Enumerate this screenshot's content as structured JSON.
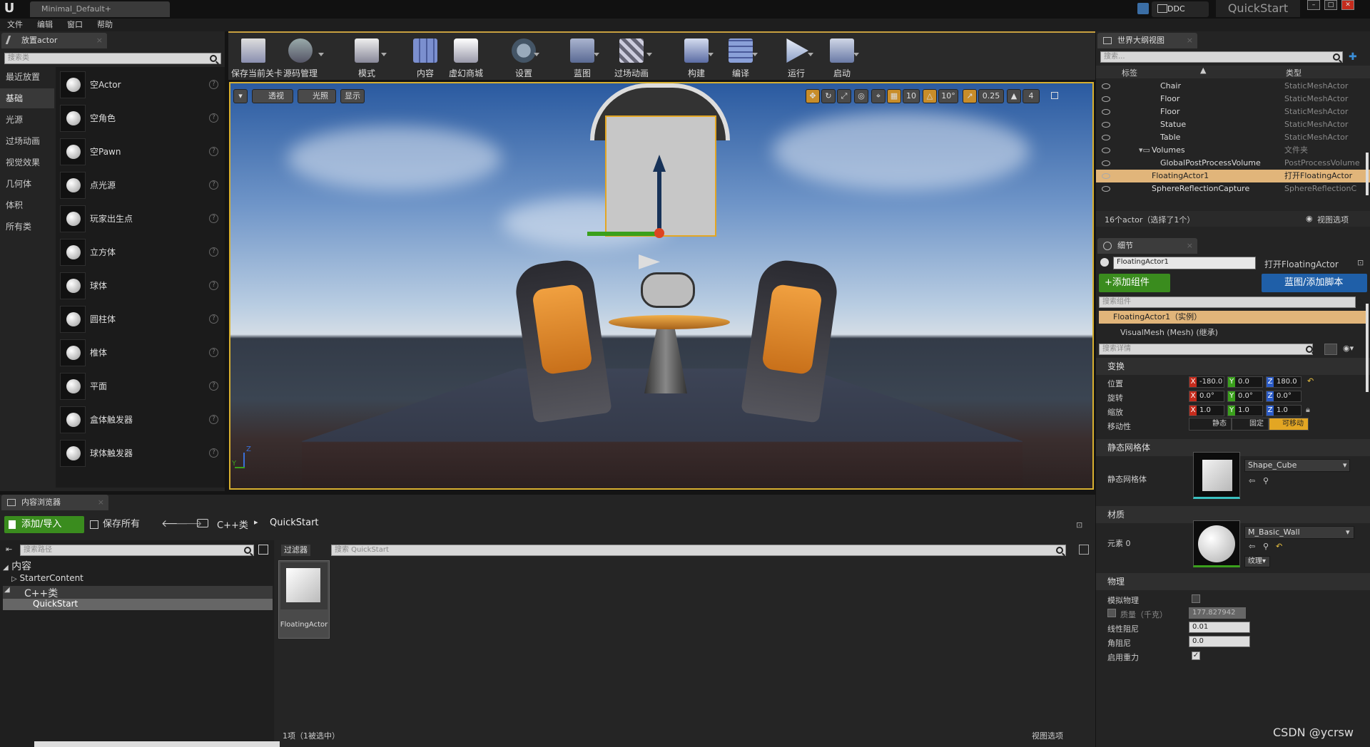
{
  "titlebar": {
    "doc_tab": "Minimal_Default+",
    "ddc": "DDC",
    "project": "QuickStart",
    "win_min": "–",
    "win_max": "□",
    "win_close": "✕"
  },
  "menu": [
    "文件",
    "编辑",
    "窗口",
    "帮助"
  ],
  "place_actor": {
    "tab_title": "放置actor",
    "search_placeholder": "搜索类",
    "categories": [
      "最近放置",
      "基础",
      "光源",
      "过场动画",
      "视觉效果",
      "几何体",
      "体积",
      "所有类"
    ],
    "selected_category": "基础",
    "actors": [
      "空Actor",
      "空角色",
      "空Pawn",
      "点光源",
      "玩家出生点",
      "立方体",
      "球体",
      "圆柱体",
      "椎体",
      "平面",
      "盒体触发器",
      "球体触发器"
    ]
  },
  "toolbar": {
    "buttons": [
      "保存当前关卡",
      "源码管理",
      "模式",
      "内容",
      "虚幻商城",
      "设置",
      "蓝图",
      "过场动画",
      "构建",
      "编译",
      "运行",
      "启动"
    ]
  },
  "viewport": {
    "dropdown": "▾",
    "perspective": "透视",
    "lit": "光照",
    "show": "显示",
    "grid_snap": "10",
    "rot_snap": "10°",
    "scale_snap": "0.25",
    "camera_speed": "4",
    "axis_z": "Z",
    "axis_y": "Y"
  },
  "world_outliner": {
    "tab_title": "世界大纲视图",
    "search_placeholder": "搜索...",
    "col_label": "标签",
    "col_type": "类型",
    "rows": [
      {
        "name": "Chair",
        "type": "StaticMeshActor",
        "indent": 2
      },
      {
        "name": "Floor",
        "type": "StaticMeshActor",
        "indent": 2
      },
      {
        "name": "Floor",
        "type": "StaticMeshActor",
        "indent": 2
      },
      {
        "name": "Statue",
        "type": "StaticMeshActor",
        "indent": 2
      },
      {
        "name": "Table",
        "type": "StaticMeshActor",
        "indent": 2
      },
      {
        "name": "Volumes",
        "type": "文件夹",
        "indent": 1
      },
      {
        "name": "GlobalPostProcessVolume",
        "type": "PostProcessVolume",
        "indent": 2
      },
      {
        "name": "FloatingActor1",
        "type": "打开FloatingActor",
        "indent": 1,
        "selected": true
      },
      {
        "name": "SphereReflectionCapture",
        "type": "SphereReflectionC",
        "indent": 1
      }
    ],
    "footer": "16个actor（选择了1个）",
    "view_options": "视图选项"
  },
  "details": {
    "tab_title": "细节",
    "actor_name": "FloatingActor1",
    "open_link": "打开FloatingActor",
    "add_component": "+添加组件",
    "blueprint_script": "蓝图/添加脚本",
    "search_components": "搜索组件",
    "instance_label": "FloatingActor1（实例）",
    "mesh_component": "VisualMesh (Mesh) (继承)",
    "search_details": "搜索详情",
    "transform": {
      "title": "变换",
      "location_label": "位置",
      "rotation_label": "旋转",
      "scale_label": "缩放",
      "mobility_label": "移动性",
      "location": [
        "-180.0",
        "0.0",
        "180.0"
      ],
      "rotation": [
        "0.0°",
        "0.0°",
        "0.0°"
      ],
      "scale": [
        "1.0",
        "1.0",
        "1.0"
      ],
      "mobility": [
        "静态",
        "固定",
        "可移动"
      ]
    },
    "static_mesh": {
      "title": "静态网格体",
      "label": "静态网格体",
      "value": "Shape_Cube"
    },
    "materials": {
      "title": "材质",
      "label": "元素 0",
      "value": "M_Basic_Wall",
      "texture_btn": "纹理▾"
    },
    "physics": {
      "title": "物理",
      "simulate": "模拟物理",
      "mass_label": "质量（千克）",
      "mass": "177.827942",
      "linear_damping_label": "线性阻尼",
      "linear_damping": "0.01",
      "angular_damping_label": "角阻尼",
      "angular_damping": "0.0",
      "gravity_label": "启用重力"
    }
  },
  "content_browser": {
    "tab_title": "内容浏览器",
    "add_import": "添加/导入",
    "save_all": "保存所有",
    "path": [
      "C++类",
      "QuickStart"
    ],
    "search_paths": "搜索路径",
    "filters": "过滤器",
    "search_placeholder": "搜索 QuickStart",
    "tree": [
      "内容",
      "StarterContent",
      "C++类",
      "QuickStart"
    ],
    "asset": "FloatingActor",
    "status": "1项（1被选中）",
    "view_options": "视图选项"
  },
  "watermark": "CSDN @ycrsw",
  "colors": {
    "accent_gold": "#d8b030",
    "selection": "#e1b57a",
    "green_button": "#3a8c1e",
    "blue_button": "#1f5fa8"
  }
}
